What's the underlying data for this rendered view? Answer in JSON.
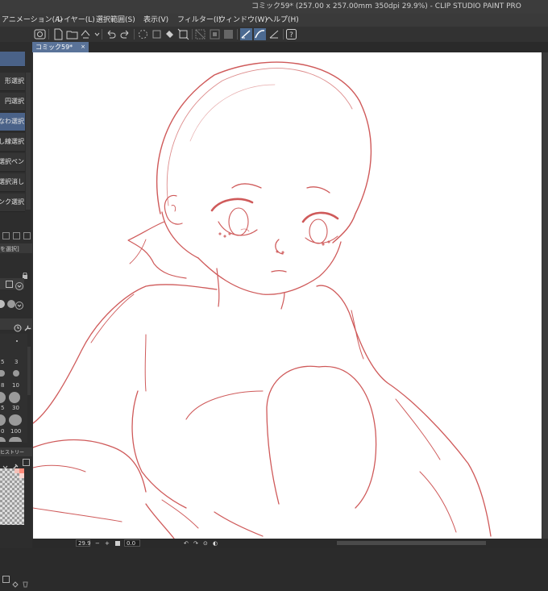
{
  "window": {
    "title": "コミック59* (257.00 x 257.00mm 350dpi 29.9%) - CLIP STUDIO PAINT PRO"
  },
  "menubar": {
    "items": [
      "アニメーション(A)",
      "レイヤー(L)",
      "選択範囲(S)",
      "表示(V)",
      "フィルター(I)",
      "ウィンドウ(W)",
      "ヘルプ(H)"
    ]
  },
  "tabs": [
    {
      "label": "コミック59*",
      "close": "×"
    }
  ],
  "subtools": {
    "items": [
      {
        "label": "形選択"
      },
      {
        "label": "円選択"
      },
      {
        "label": "なわ選択"
      },
      {
        "label": "し線選択"
      },
      {
        "label": "選択ペン"
      },
      {
        "label": "選択消し"
      },
      {
        "label": "ンク選択"
      }
    ],
    "selected_index": 2
  },
  "tool_property": {
    "title": "を選択]"
  },
  "brush_size_panel": {
    "sizes": [
      "5",
      "3",
      "8",
      "10",
      "5",
      "30",
      "0",
      "100"
    ]
  },
  "color_history": {
    "title": "ヒストリー"
  },
  "status": {
    "zoom": "29.9",
    "angle": "0.0"
  },
  "colors": {
    "line_art": "#cf5a5a",
    "accent": "#4a6288",
    "canvas": "#ffffff"
  }
}
